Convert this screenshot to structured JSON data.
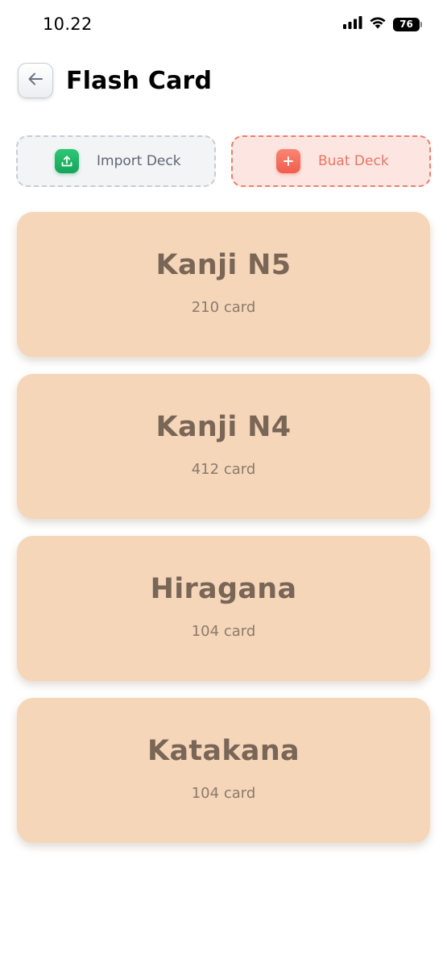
{
  "status_bar": {
    "time": "10.22",
    "battery": "76",
    "icons": [
      "signal-icon",
      "wifi-icon",
      "battery-icon"
    ]
  },
  "header": {
    "back_icon": "arrow-left-icon",
    "title": "Flash Card"
  },
  "actions": {
    "import": {
      "label": "Import Deck",
      "icon": "upload-icon"
    },
    "create": {
      "label": "Buat Deck",
      "icon": "plus-icon"
    }
  },
  "decks": [
    {
      "title": "Kanji N5",
      "count": "210 card"
    },
    {
      "title": "Kanji N4",
      "count": "412 card"
    },
    {
      "title": "Hiragana",
      "count": "104 card"
    },
    {
      "title": "Katakana",
      "count": "104 card"
    }
  ],
  "colors": {
    "card_bg": "#f5d6b9",
    "card_text": "#7a6657",
    "import_accent": "#16a35a",
    "create_accent": "#ef5e4d",
    "create_bg": "#fde6e1"
  }
}
